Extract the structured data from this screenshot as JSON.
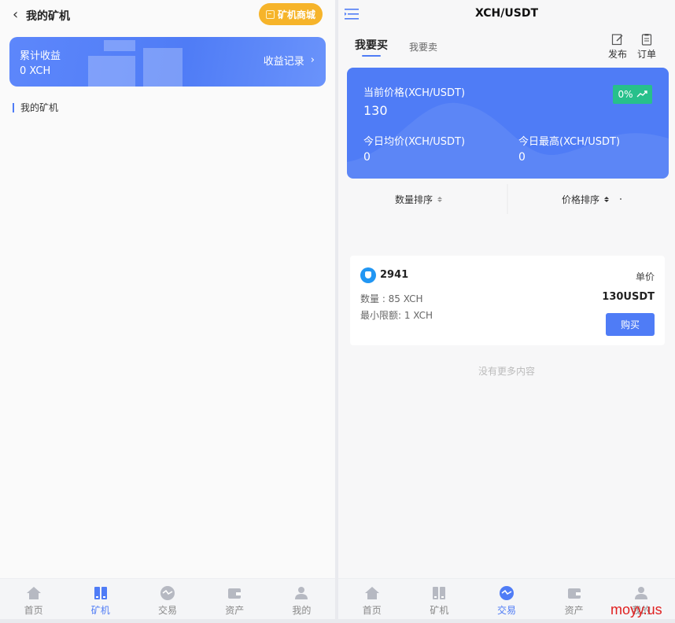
{
  "left": {
    "title": "我的矿机",
    "shop_button": "矿机商城",
    "earnings": {
      "label": "累计收益",
      "value": "0 XCH",
      "record_link": "收益记录"
    },
    "section_title": "我的矿机"
  },
  "right": {
    "title": "XCH/USDT",
    "tabs": {
      "buy": "我要买",
      "sell": "我要卖"
    },
    "actions": {
      "publish": "发布",
      "orders": "订单"
    },
    "price_card": {
      "current_label": "当前价格(XCH/USDT)",
      "current_value": "130",
      "change": "0%",
      "avg_label": "今日均价(XCH/USDT)",
      "avg_value": "0",
      "high_label": "今日最高(XCH/USDT)",
      "high_value": "0"
    },
    "sort": {
      "quantity": "数量排序",
      "price": "价格排序"
    },
    "order": {
      "seller": "2941",
      "unit_label": "单价",
      "quantity": "数量 : 85 XCH",
      "min_limit": "最小限额: 1 XCH",
      "unit_price": "130USDT",
      "buy_button": "购买"
    },
    "no_more": "没有更多内容"
  },
  "tabbar": {
    "items": [
      "首页",
      "矿机",
      "交易",
      "资产",
      "我的"
    ],
    "left_active": "矿机",
    "right_active": "交易"
  },
  "colors": {
    "accent": "#4f7cf6",
    "shop": "#f6b42a",
    "up": "#27c08b"
  },
  "watermark": "moyy.us"
}
